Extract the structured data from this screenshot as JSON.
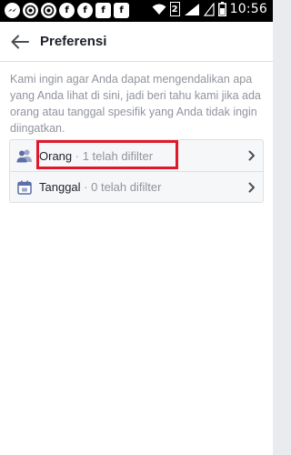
{
  "status_bar": {
    "time": "10:56",
    "sim_label": "2",
    "notification_icons": [
      "messenger-icon",
      "chrome-icon",
      "chrome-icon",
      "facebook-icon",
      "facebook-icon",
      "facebook-icon",
      "facebook-icon"
    ]
  },
  "header": {
    "title": "Preferensi"
  },
  "intro_text": "Kami ingin agar Anda dapat mengendalikan apa yang Anda lihat di sini, jadi beri tahu kami jika ada orang atau tanggal spesifik yang Anda tidak ingin diingatkan.",
  "filters": [
    {
      "label": "Orang",
      "separator": " · ",
      "count_text": "1 telah difilter",
      "icon": "people-icon"
    },
    {
      "label": "Tanggal",
      "separator": " · ",
      "count_text": "0 telah difilter",
      "icon": "calendar-icon"
    }
  ],
  "colors": {
    "accent": "#4267b2",
    "highlight": "#e0192a"
  }
}
